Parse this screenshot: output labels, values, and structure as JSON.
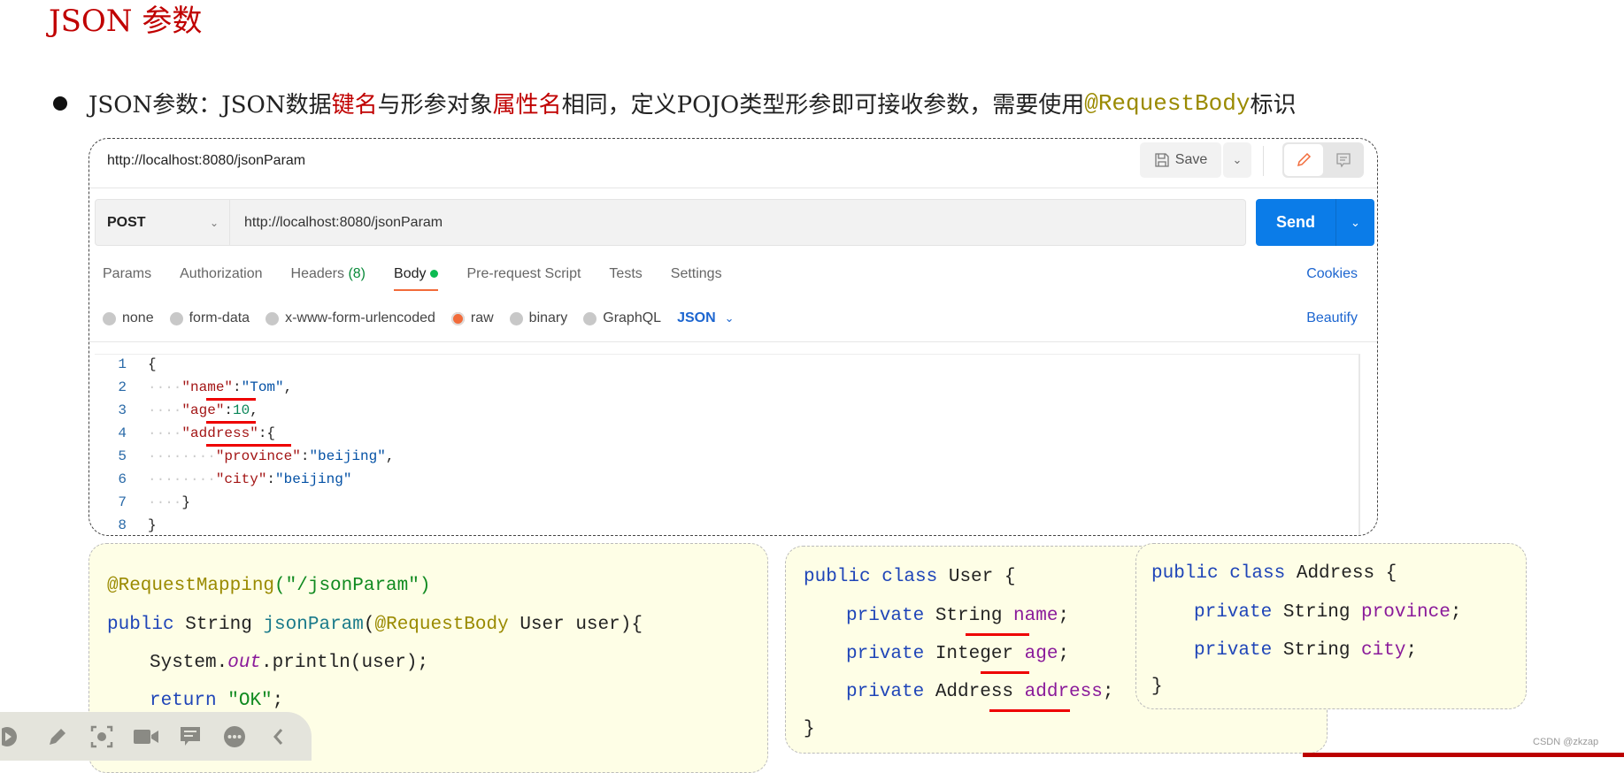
{
  "slide": {
    "title": "JSON 参数",
    "bullet": {
      "p1": "JSON参数：JSON数据",
      "p2": "键名",
      "p3": "与形参对象",
      "p4": "属性名",
      "p5": "相同，定义POJO类型形参即可接收参数，需要使用 ",
      "p6": "@RequestBody",
      "p7": " 标识"
    }
  },
  "postman": {
    "request_name": "http://localhost:8080/jsonParam",
    "save_label": "Save",
    "method": "POST",
    "url": "http://localhost:8080/jsonParam",
    "send_label": "Send",
    "tabs": [
      {
        "label": "Params"
      },
      {
        "label": "Authorization"
      },
      {
        "label": "Headers",
        "count": "(8)"
      },
      {
        "label": "Body"
      },
      {
        "label": "Pre-request Script"
      },
      {
        "label": "Tests"
      },
      {
        "label": "Settings"
      }
    ],
    "active_tab": "Body",
    "cookies_label": "Cookies",
    "body_types": [
      "none",
      "form-data",
      "x-www-form-urlencoded",
      "raw",
      "binary",
      "GraphQL"
    ],
    "selected_body_type": "raw",
    "format": "JSON",
    "beautify_label": "Beautify",
    "line_numbers": [
      "1",
      "2",
      "3",
      "4",
      "5",
      "6",
      "7",
      "8"
    ],
    "json_tokens": {
      "open": "{",
      "name_key": "\"name\"",
      "name_val": "\"Tom\"",
      "age_key": "\"age\"",
      "age_val": "10",
      "address_key": "\"address\"",
      "province_key": "\"province\"",
      "province_val": "\"beijing\"",
      "city_key": "\"city\"",
      "city_val": "\"beijing\"",
      "close_inner": "}",
      "close": "}"
    },
    "colors": {
      "send": "#0b7ce8",
      "accent": "#f26b3a",
      "link": "#1d66d0"
    }
  },
  "controller_code": {
    "annotation": "@RequestMapping",
    "path": "(\"/jsonParam\")",
    "public": "public",
    "string": " String ",
    "method": "jsonParam",
    "param_ann": "@RequestBody",
    "params": " User user){",
    "sys": "System.",
    "out": "out",
    ".println": ".println(user);",
    "return": "return",
    "ok": "\"OK\"",
    "semi": ";",
    "close": "}"
  },
  "user_class": {
    "public_class": "public class",
    "name": " User {",
    "fields": [
      {
        "mod": "private",
        "type": " String ",
        "name": "name"
      },
      {
        "mod": "private",
        "type": " Integer ",
        "name": "age"
      },
      {
        "mod": "private",
        "type": " Address ",
        "name": "address"
      }
    ],
    "close": "}"
  },
  "address_class": {
    "public_class": "public class",
    "name": " Address {",
    "fields": [
      {
        "mod": "private",
        "type": " String ",
        "name": "province"
      },
      {
        "mod": "private",
        "type": " String ",
        "name": "city"
      }
    ],
    "close": "}"
  },
  "watermark": "CSDN @zkzap"
}
